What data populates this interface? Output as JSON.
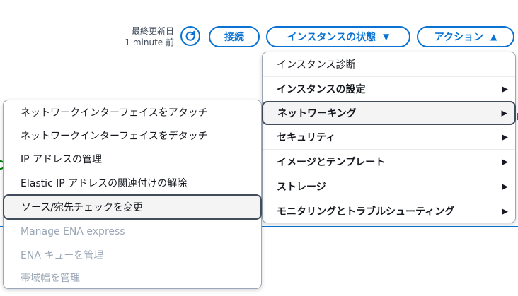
{
  "header": {
    "last_updated_label": "最終更新日",
    "last_updated_value": "1 minute 前",
    "refresh_icon": "refresh-icon",
    "connect_label": "接続",
    "instance_state_label": "インスタンスの状態",
    "instance_state_caret": "▼",
    "actions_label": "アクション",
    "actions_caret": "▲"
  },
  "actions_menu": {
    "items": [
      {
        "label": "インスタンス診断",
        "submenu": false,
        "arrow": ""
      },
      {
        "label": "インスタンスの設定",
        "submenu": true,
        "arrow": "▶"
      },
      {
        "label": "ネットワーキング",
        "submenu": true,
        "arrow": "▶",
        "highlighted": true
      },
      {
        "label": "セキュリティ",
        "submenu": true,
        "arrow": "▶"
      },
      {
        "label": "イメージとテンプレート",
        "submenu": true,
        "arrow": "▶"
      },
      {
        "label": "ストレージ",
        "submenu": true,
        "arrow": "▶"
      },
      {
        "label": "モニタリングとトラブルシューティング",
        "submenu": true,
        "arrow": "▶"
      }
    ]
  },
  "networking_submenu": {
    "items": [
      {
        "label": "ネットワークインターフェイスをアタッチ",
        "disabled": false
      },
      {
        "label": "ネットワークインターフェイスをデタッチ",
        "disabled": false
      },
      {
        "label": "IP アドレスの管理",
        "disabled": false
      },
      {
        "label": "Elastic IP アドレスの関連付けの解除",
        "disabled": false
      },
      {
        "label": "ソース/宛先チェックを変更",
        "disabled": false,
        "highlighted": true
      },
      {
        "label": "Manage ENA express",
        "disabled": true
      },
      {
        "label": "ENA キューを管理",
        "disabled": true
      },
      {
        "label": "帯域幅を管理",
        "disabled": true
      }
    ]
  },
  "colors": {
    "accent": "#0972d3",
    "text": "#16191f",
    "disabled": "#9ba7b6",
    "success": "#037f0c"
  }
}
